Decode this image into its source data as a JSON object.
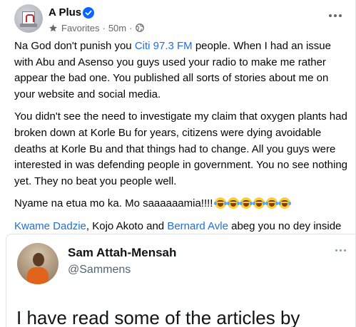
{
  "post": {
    "author": "A Plus",
    "audience": "Favorites",
    "time": "50m",
    "separator": "·",
    "paragraphs": {
      "p1": {
        "before": "Na God don't punish you ",
        "link": "Citi 97.3 FM",
        "after": " people. When I had an issue with Abu and Asenso you guys used your radio to make me rather appear the bad one. You published all sorts of stories about me on your website and social media."
      },
      "p2": "You didn't see the need to investigate my claim that oxygen plants had broken down at Korle Bu for years, citizens were dying avoidable deaths at Korle Bu and that things had to change. All you guys were interested in was defending people in government. You no see nothing yet. They no beat you people well.",
      "p3": "Nyame na etua mo ka. Mo saaaaaamia!!!!",
      "p3_emoji": [
        "laughing-crying-emoji",
        "laughing-crying-emoji",
        "laughing-crying-emoji",
        "laughing-crying-emoji",
        "laughing-crying-emoji",
        "laughing-crying-emoji"
      ],
      "p4": {
        "mention1": "Kwame Dadzie",
        "mid": ", Kojo Akoto and ",
        "mention2": "Bernard Avle",
        "after": " abeg you no dey inside ok. They know themselves."
      }
    }
  },
  "embed": {
    "name": "Sam Attah-Mensah",
    "handle": "@Sammens",
    "text": "I have read some of the articles by"
  },
  "colors": {
    "link": "#216fdb",
    "verified": "#0866ff",
    "meta": "#65676b"
  }
}
